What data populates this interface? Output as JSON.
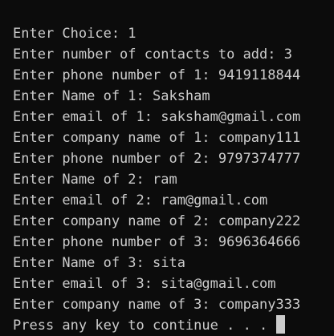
{
  "console": {
    "lines": [
      "Enter Choice: 1",
      "Enter number of contacts to add: 3",
      "Enter phone number of 1: 9419118844",
      "Enter Name of 1: Saksham",
      "Enter email of 1: saksham@gmail.com",
      "Enter company name of 1: company111",
      "Enter phone number of 2: 9797374777",
      "Enter Name of 2: ram",
      "Enter email of 2: ram@gmail.com",
      "Enter company name of 2: company222",
      "Enter phone number of 3: 9696364666",
      "Enter Name of 3: sita",
      "Enter email of 3: sita@gmail.com",
      "Enter company name of 3: company333"
    ],
    "prompt": "Press any key to continue . . . "
  },
  "colors": {
    "background": "#0c0c0c",
    "foreground": "#cccccc"
  }
}
